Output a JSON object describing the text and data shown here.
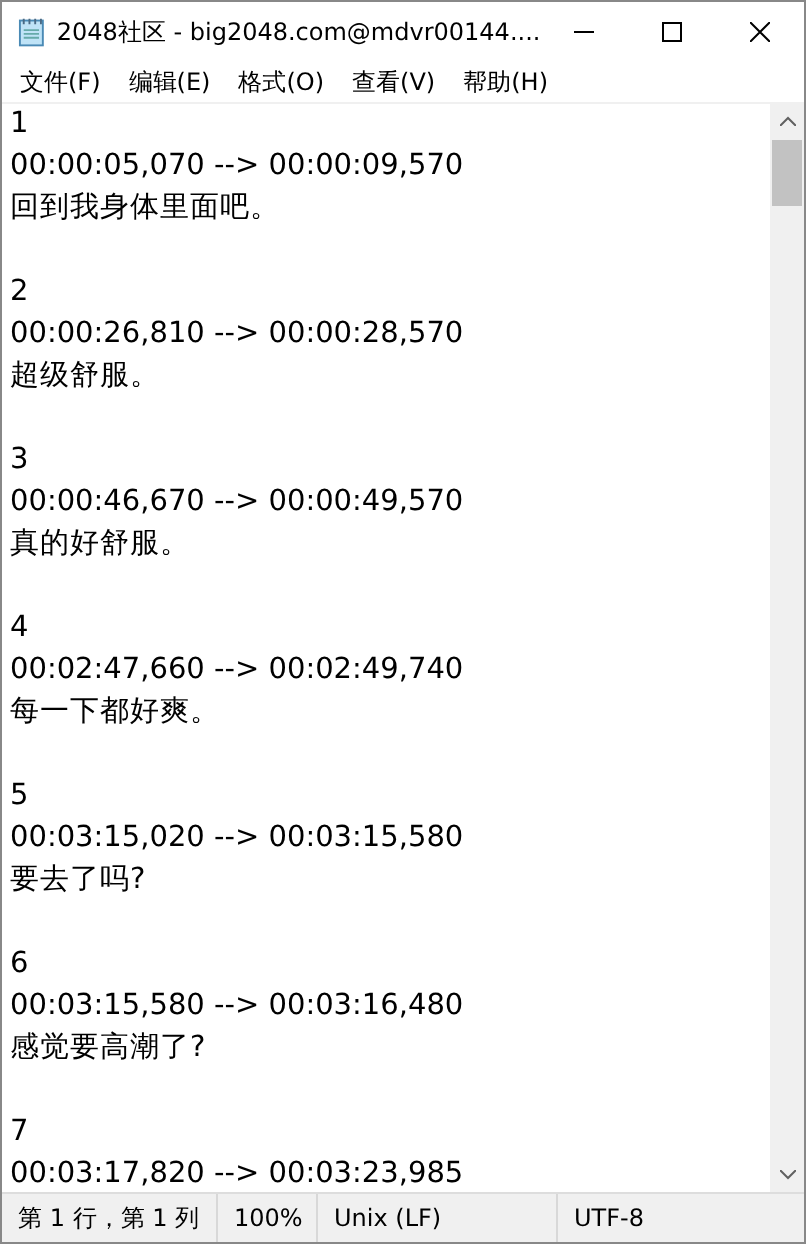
{
  "window": {
    "title": "2048社区 - big2048.com@mdvr00144...."
  },
  "menu": [
    "文件(F)",
    "编辑(E)",
    "格式(O)",
    "查看(V)",
    "帮助(H)"
  ],
  "editor": {
    "entries": [
      {
        "number": "1",
        "timing": "00:00:05,070 --> 00:00:09,570",
        "text": "回到我身体里面吧。"
      },
      {
        "number": "2",
        "timing": "00:00:26,810 --> 00:00:28,570",
        "text": "超级舒服。"
      },
      {
        "number": "3",
        "timing": "00:00:46,670 --> 00:00:49,570",
        "text": "真的好舒服。"
      },
      {
        "number": "4",
        "timing": "00:02:47,660 --> 00:02:49,740",
        "text": "每一下都好爽。"
      },
      {
        "number": "5",
        "timing": "00:03:15,020 --> 00:03:15,580",
        "text": "要去了吗?"
      },
      {
        "number": "6",
        "timing": "00:03:15,580 --> 00:03:16,480",
        "text": "感觉要高潮了?"
      },
      {
        "number": "7",
        "timing": "00:03:17,820 --> 00:03:23,985"
      }
    ]
  },
  "status_bar": [
    "第 1 行，第 1 列",
    "100%",
    "Unix (LF)",
    "UTF-8"
  ]
}
